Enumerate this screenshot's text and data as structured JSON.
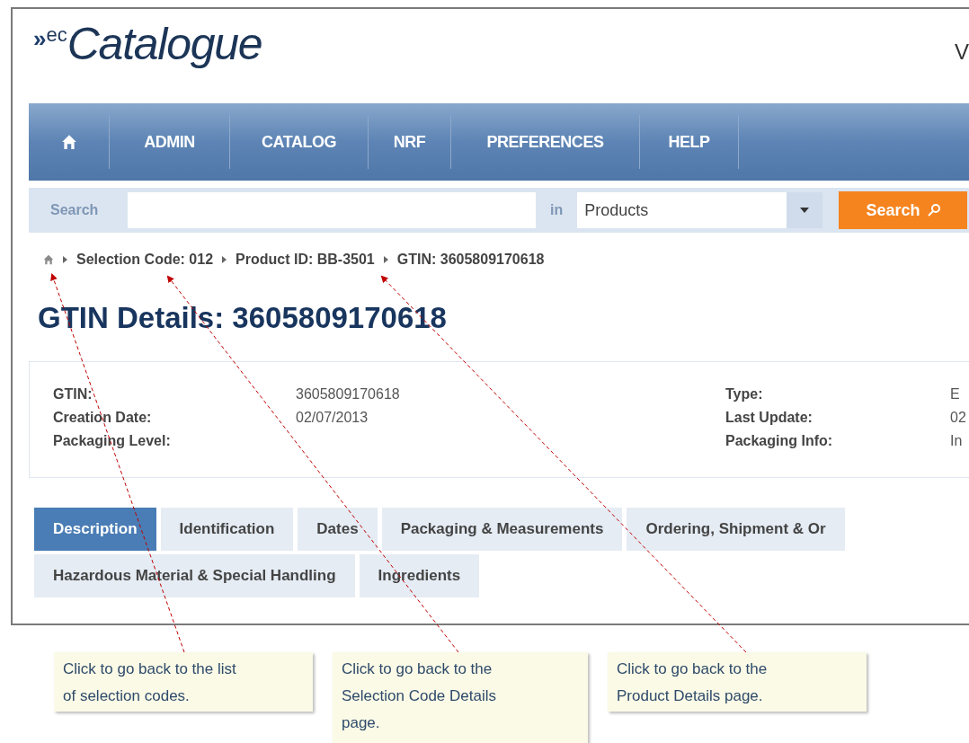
{
  "logo": {
    "mark": "»",
    "prefix": "ec",
    "name": "Catalogue"
  },
  "header_cut_text": "V",
  "nav": {
    "items": [
      {
        "kind": "home"
      },
      {
        "kind": "text",
        "label": "ADMIN"
      },
      {
        "kind": "text",
        "label": "CATALOG"
      },
      {
        "kind": "text",
        "label": "NRF"
      },
      {
        "kind": "text",
        "label": "PREFERENCES"
      },
      {
        "kind": "text",
        "label": "HELP"
      }
    ]
  },
  "search": {
    "label": "Search",
    "in_label": "in",
    "scope": "Products",
    "button": "Search"
  },
  "breadcrumb": [
    "Selection Code: 012",
    "Product ID: BB-3501",
    "GTIN: 3605809170618"
  ],
  "heading": "GTIN Details: 3605809170618",
  "details": {
    "left": [
      {
        "label": "GTIN:",
        "value": "3605809170618"
      },
      {
        "label": "Creation Date:",
        "value": "02/07/2013"
      },
      {
        "label": "Packaging Level:"
      }
    ],
    "right": [
      {
        "label": "Type:",
        "value": "E"
      },
      {
        "label": "Last Update:",
        "value": "02"
      },
      {
        "label": "Packaging Info:",
        "value": "In"
      }
    ]
  },
  "tabs": [
    [
      {
        "label": "Description",
        "selected": true
      },
      {
        "label": "Identification",
        "selected": false
      },
      {
        "label": "Dates",
        "selected": false
      },
      {
        "label": "Packaging & Measurements",
        "selected": false
      },
      {
        "label": "Ordering, Shipment & Or",
        "selected": false
      }
    ],
    [
      {
        "label": "Hazardous Material & Special Handling",
        "selected": false
      },
      {
        "label": "Ingredients",
        "selected": false
      }
    ]
  ],
  "callouts": [
    "Click to go back to the list of selection codes.",
    "Click to go back to the Selection Code Details page.",
    "Click to go back to the Product Details page."
  ]
}
